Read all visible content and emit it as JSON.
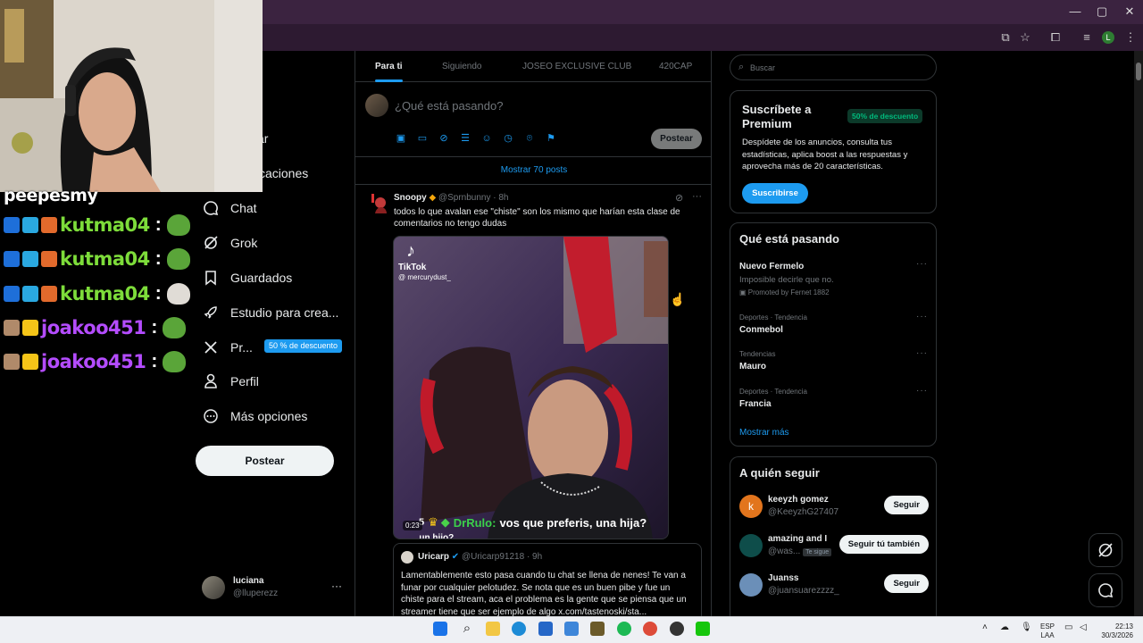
{
  "window": {
    "controls": [
      "minimize",
      "maximize",
      "close"
    ],
    "toolbar_icons": [
      "screencast-icon",
      "star-icon",
      "extension-icon",
      "media-icon",
      "profile-icon",
      "menu-icon"
    ],
    "profile_initial": "L"
  },
  "stream_chat": [
    {
      "name": "peepesmy",
      "color": "#ffffff"
    },
    {
      "name": "kutma04",
      "color": "#7ddc3a"
    },
    {
      "name": "kutma04",
      "color": "#7ddc3a"
    },
    {
      "name": "kutma04",
      "color": "#7ddc3a"
    },
    {
      "name": "joakoo451",
      "color": "#b44cff"
    },
    {
      "name": "joakoo451",
      "color": "#b44cff"
    }
  ],
  "sidebar": {
    "items": [
      {
        "label": "ar",
        "icon": "search-icon"
      },
      {
        "label": "caciones",
        "icon": "bell-icon"
      },
      {
        "label": "Chat",
        "icon": "chat-icon"
      },
      {
        "label": "Grok",
        "icon": "grok-icon"
      },
      {
        "label": "Guardados",
        "icon": "bookmark-icon"
      },
      {
        "label": "Estudio para crea...",
        "icon": "rocket-icon"
      },
      {
        "label": "Pr...",
        "icon": "x-logo-icon"
      },
      {
        "label": "Perfil",
        "icon": "person-icon"
      },
      {
        "label": "Más opciones",
        "icon": "more-circle-icon"
      }
    ],
    "premium_badge": "50 % de descuento",
    "post_button": "Postear",
    "user": {
      "name": "luciana",
      "handle": "@lluperezz",
      "more": "···"
    }
  },
  "timeline": {
    "tabs": [
      "Para ti",
      "Siguiendo",
      "JOSEO EXCLUSIVE CLUB",
      "420CAP"
    ],
    "composer_placeholder": "¿Qué está pasando?",
    "post_button": "Postear",
    "show_posts": "Mostrar 70 posts",
    "tweet": {
      "name": "Snoopy",
      "handle": "@Sprnbunny",
      "time": "· 8h",
      "text": "todos lo que avalan ese \"chiste\" son los mismo que harían esta clase de comentarios no tengo dudas",
      "video": {
        "watermark": "TikTok",
        "watermark_user": "@ mercurydust_",
        "caption_prefix": "5",
        "caption_user": "DrRulo:",
        "caption_text": "vos que preferis, una hija?",
        "caption_more": "...un hijo?",
        "duration": "0:23"
      },
      "quote": {
        "name": "Uricarp",
        "handle": "@Uricarp91218",
        "time": "· 9h",
        "text": "Lamentablemente esto pasa cuando tu chat se llena de nenes! Te van a funar por cualquier pelotudez. Se nota que es un buen pibe y fue un chiste para el stream, aca el problema es la gente que se piensa que un streamer tiene que ser ejemplo de algo x.com/tastenoski/sta..."
      }
    }
  },
  "right": {
    "search_placeholder": "Buscar",
    "premium": {
      "title": "Suscríbete a Premium",
      "badge": "50% de descuento",
      "body": "Despídete de los anuncios, consulta tus estadísticas, aplica boost a las respuestas y aprovecha más de 20 características.",
      "button": "Suscribirse"
    },
    "trends": {
      "title": "Qué está pasando",
      "items": [
        {
          "meta": "",
          "name": "Nuevo Fermelo",
          "sub": "Imposible decirle que no.",
          "promo": "Promoted by Fernet 1882"
        },
        {
          "meta": "Deportes · Tendencia",
          "name": "Conmebol"
        },
        {
          "meta": "Tendencias",
          "name": "Mauro"
        },
        {
          "meta": "Deportes · Tendencia",
          "name": "Francia"
        }
      ],
      "more": "Mostrar más"
    },
    "follow": {
      "title": "A quién seguir",
      "items": [
        {
          "name": "keeyzh gomez",
          "handle": "@KeeyzhG27407",
          "button": "Seguir",
          "avatar_color": "#e2751d",
          "initial": "k"
        },
        {
          "name": "amazing and I",
          "handle": "@was...",
          "tag": "Te sigue",
          "button": "Seguir tú también",
          "avatar_color": "#0e4d4a",
          "initial": ""
        },
        {
          "name": "Juanss",
          "handle": "@juansuarezzzz_",
          "button": "Seguir",
          "avatar_color": "#6b8fb8",
          "initial": ""
        }
      ]
    }
  },
  "taskbar": {
    "lang_top": "ESP",
    "lang_bottom": "LAA",
    "time": "22:13",
    "date": "30/3/2026"
  }
}
